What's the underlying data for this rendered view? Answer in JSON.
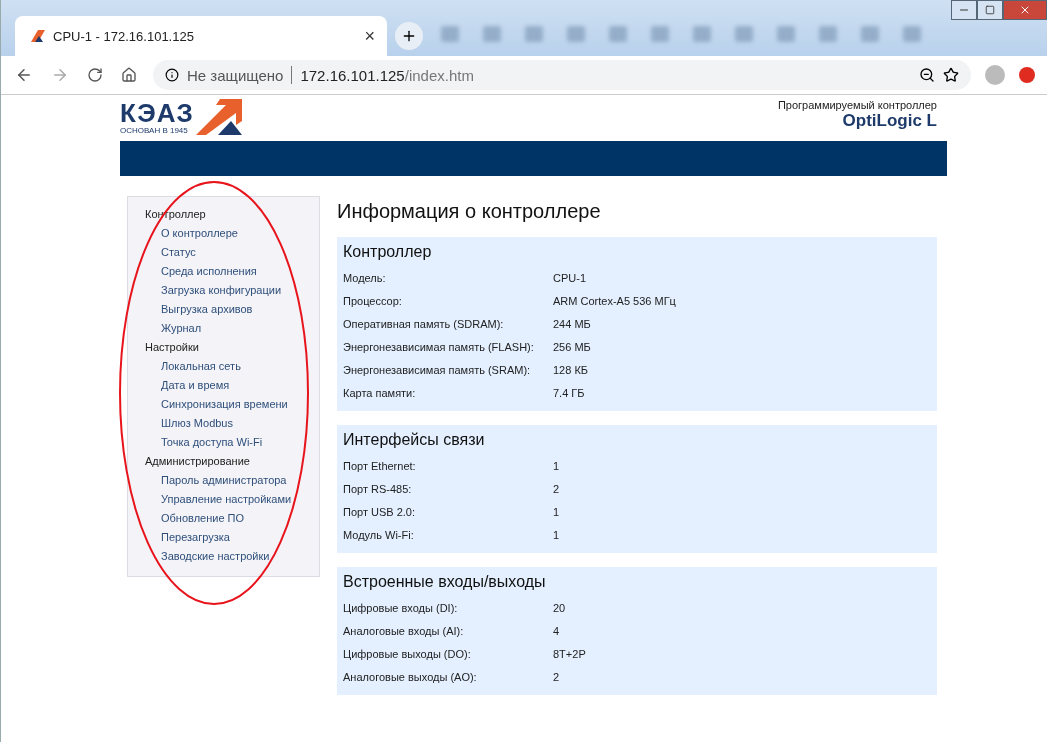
{
  "browser": {
    "tab_title": "CPU-1 - 172.16.101.125",
    "tab_close": "×",
    "security_label": "Не защищено",
    "url_host": "172.16.101.125",
    "url_path": "/index.htm"
  },
  "header": {
    "logo_text": "КЭАЗ",
    "logo_tagline": "ОСНОВАН В 1945",
    "subtitle": "Программируемый контроллер",
    "product": "OptiLogic L"
  },
  "sidebar": {
    "groups": [
      {
        "label": "Контроллер",
        "children": [
          {
            "label": "О контроллере"
          },
          {
            "label": "Статус"
          },
          {
            "label": "Среда исполнения"
          },
          {
            "label": "Загрузка конфигурации"
          },
          {
            "label": "Выгрузка архивов"
          },
          {
            "label": "Журнал"
          }
        ]
      },
      {
        "label": "Настройки",
        "children": [
          {
            "label": "Локальная сеть"
          },
          {
            "label": "Дата и время"
          },
          {
            "label": "Синхронизация времени"
          },
          {
            "label": "Шлюз Modbus"
          },
          {
            "label": "Точка доступа Wi-Fi"
          }
        ]
      },
      {
        "label": "Администрирование",
        "children": [
          {
            "label": "Пароль администратора"
          },
          {
            "label": "Управление настройками"
          },
          {
            "label": "Обновление ПО"
          },
          {
            "label": "Перезагрузка"
          },
          {
            "label": "Заводские настройки"
          }
        ]
      }
    ]
  },
  "main": {
    "title": "Информация о контроллере",
    "sections": [
      {
        "title": "Контроллер",
        "rows": [
          {
            "label": "Модель:",
            "value": "CPU-1"
          },
          {
            "label": "Процессор:",
            "value": "ARM Cortex-A5 536 МГц"
          },
          {
            "label": "Оперативная память (SDRAM):",
            "value": "244 МБ"
          },
          {
            "label": "Энергонезависимая память (FLASH):",
            "value": "256 МБ"
          },
          {
            "label": "Энергонезависимая память (SRAM):",
            "value": "128 КБ"
          },
          {
            "label": "Карта памяти:",
            "value": "7.4 ГБ"
          }
        ]
      },
      {
        "title": "Интерфейсы связи",
        "rows": [
          {
            "label": "Порт Ethernet:",
            "value": "1"
          },
          {
            "label": "Порт RS-485:",
            "value": "2"
          },
          {
            "label": "Порт USB 2.0:",
            "value": "1"
          },
          {
            "label": "Модуль Wi-Fi:",
            "value": "1"
          }
        ]
      },
      {
        "title": "Встроенные входы/выходы",
        "rows": [
          {
            "label": "Цифровые входы (DI):",
            "value": "20"
          },
          {
            "label": "Аналоговые входы (AI):",
            "value": "4"
          },
          {
            "label": "Цифровые выходы (DO):",
            "value": "8T+2P"
          },
          {
            "label": "Аналоговые выходы (AO):",
            "value": "2"
          }
        ]
      }
    ]
  },
  "annotation": {
    "kind": "ellipse",
    "color": "#e8141c"
  }
}
